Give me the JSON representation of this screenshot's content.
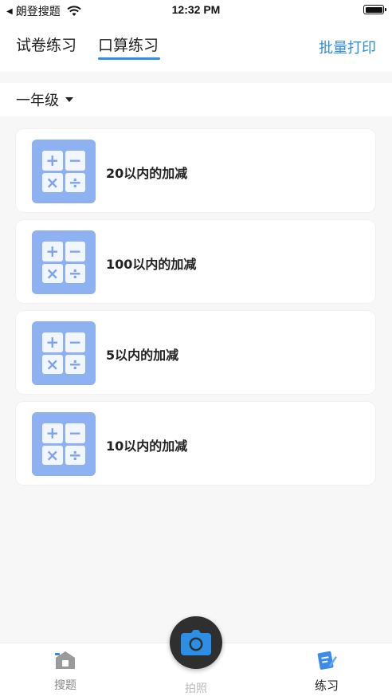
{
  "status_bar": {
    "carrier": "朗登搜题",
    "time": "12:32 PM"
  },
  "header": {
    "tabs": [
      {
        "label": "试卷练习",
        "active": false
      },
      {
        "label": "口算练习",
        "active": true
      }
    ],
    "print_label": "批量打印",
    "accent_color": "#2d8ee6"
  },
  "grade_selector": {
    "value": "一年级"
  },
  "exercises": [
    {
      "title": "20以内的加减",
      "icon": "calculator-icon"
    },
    {
      "title": "100以内的加减",
      "icon": "calculator-icon"
    },
    {
      "title": "5以内的加减",
      "icon": "calculator-icon"
    },
    {
      "title": "10以内的加减",
      "icon": "calculator-icon"
    }
  ],
  "calc_symbols": [
    "+",
    "−",
    "×",
    "÷"
  ],
  "bottom_nav": {
    "items": [
      {
        "label": "搜题",
        "icon": "house-icon",
        "active": false
      },
      {
        "label": "拍照",
        "icon": "camera-icon",
        "active": false
      },
      {
        "label": "练习",
        "icon": "practice-icon",
        "active": true
      }
    ]
  }
}
